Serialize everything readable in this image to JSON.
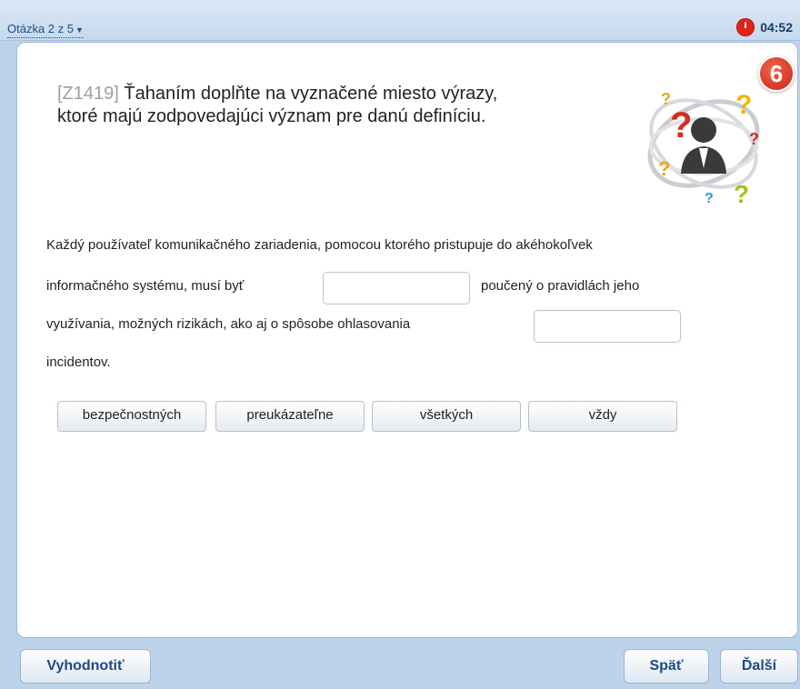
{
  "header": {
    "question_nav": "Otázka 2 z 5",
    "timer": "04:52"
  },
  "question": {
    "id": "[Z1419]",
    "text": "Ťahaním doplňte na vyznačené miesto výrazy,",
    "text2": "ktoré majú zodpovedajúci význam pre danú definíciu.",
    "badge": "6"
  },
  "body": {
    "line1": "Každý používateľ komunikačného zariadenia, pomocou ktorého pristupuje do akéhokoľvek",
    "line2a": "informačného systému, musí byť",
    "line2b": "poučený o pravidlách jeho",
    "line3a": "využívania, možných rizikách, ako aj o spôsobe ohlasovania",
    "line4": "incidentov."
  },
  "options": [
    "bezpečnostných",
    "preukázateľne",
    "všetkých",
    "vždy"
  ],
  "footer": {
    "evaluate_label": "Vyhodnotiť",
    "back_label": "Späť",
    "next_label": "Ďalší"
  },
  "colors": {
    "accent": "#1c4a86",
    "timer": "#e0241b",
    "background": "#bcd3ea"
  }
}
